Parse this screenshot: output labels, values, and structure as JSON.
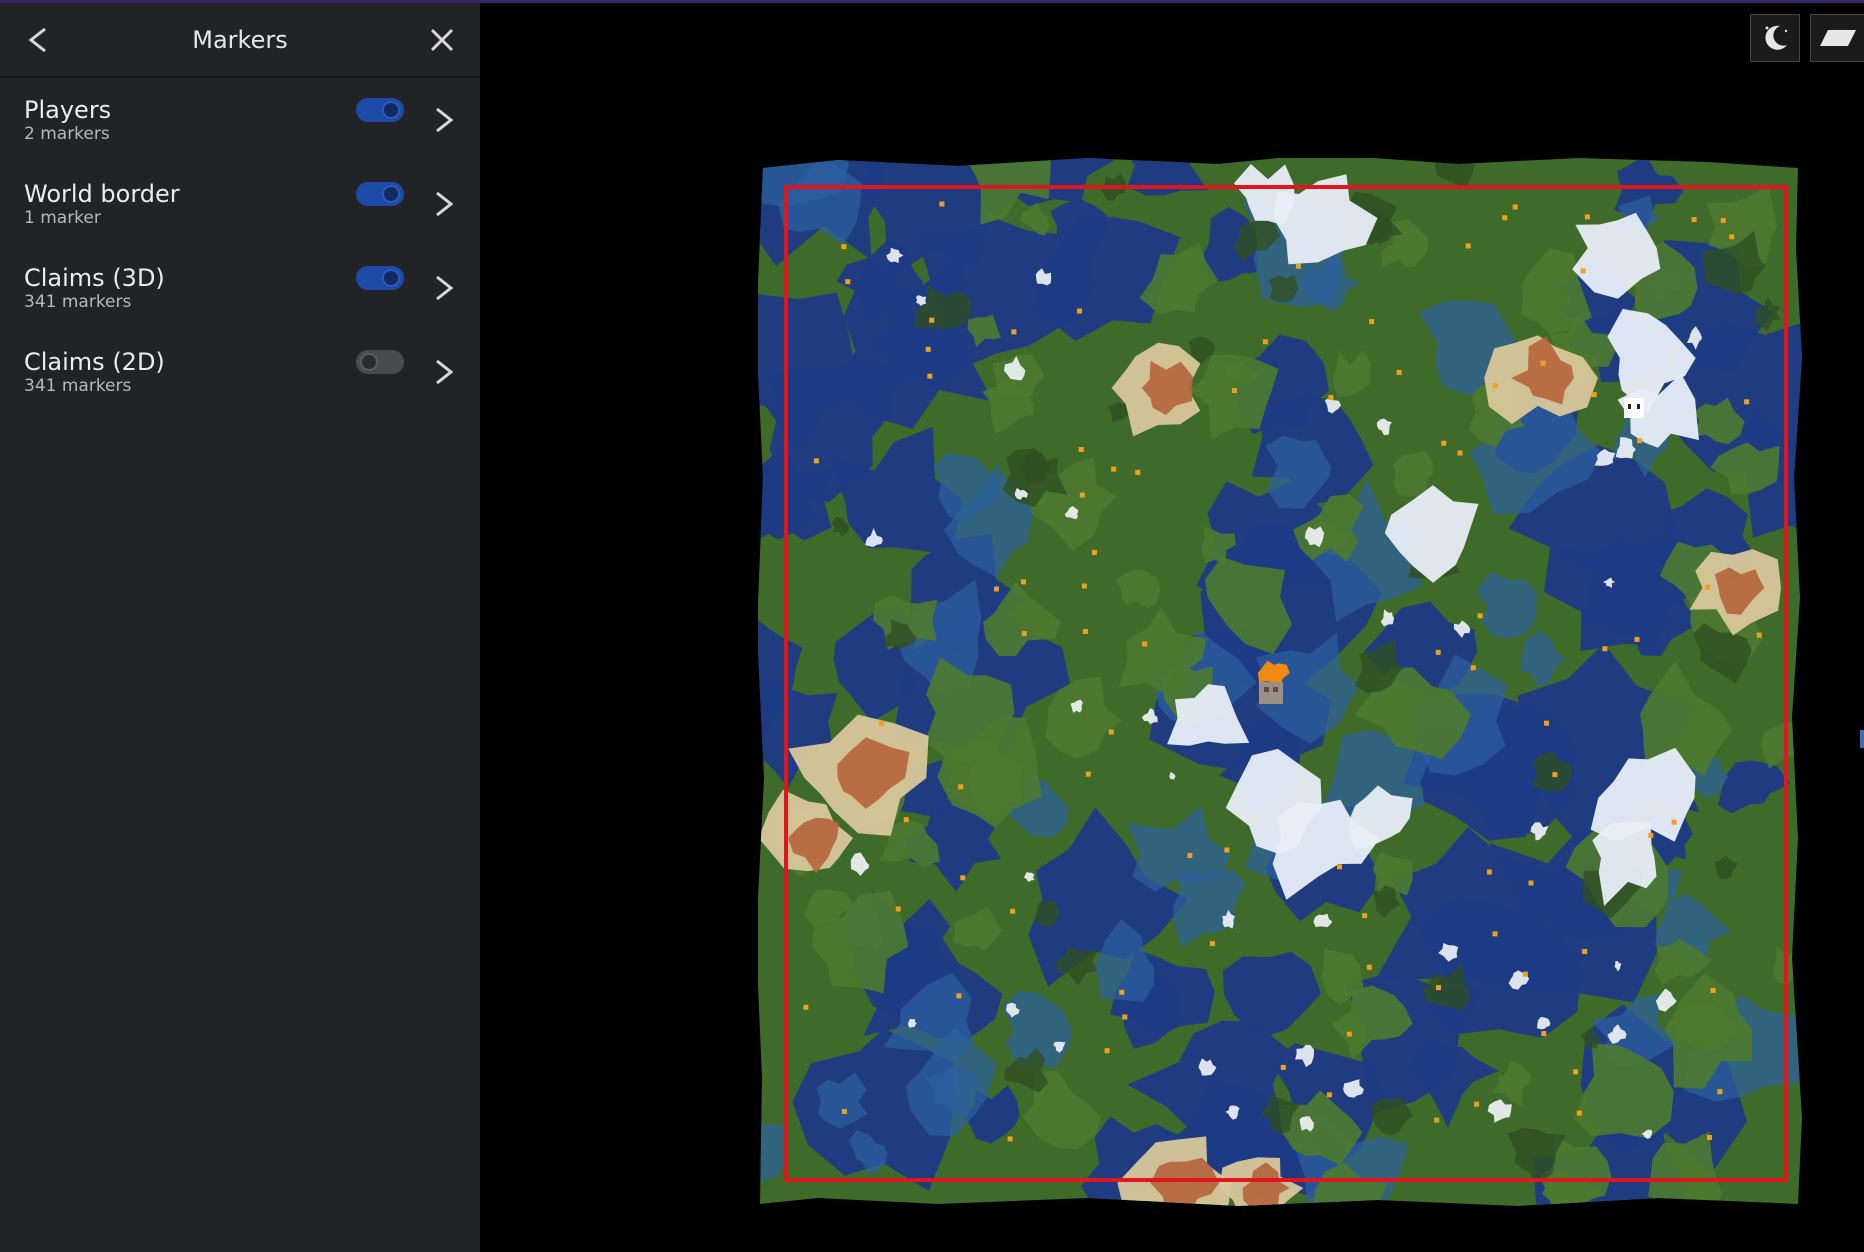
{
  "sidebar": {
    "title": "Markers",
    "back_icon": "chevron-left-icon",
    "close_icon": "close-icon",
    "items": [
      {
        "label": "Players",
        "count": "2 markers",
        "enabled": true
      },
      {
        "label": "World border",
        "count": "1 marker",
        "enabled": true
      },
      {
        "label": "Claims (3D)",
        "count": "341 markers",
        "enabled": true
      },
      {
        "label": "Claims (2D)",
        "count": "341 markers",
        "enabled": false
      }
    ]
  },
  "controls": {
    "night_icon": "moon-icon",
    "view_icon": "flat-view-icon"
  },
  "colors": {
    "sidebar_bg": "#222326",
    "toggle_on": "#1f4ba8",
    "toggle_off": "#4a4b4e",
    "world_border": "#e0161e",
    "ocean": "#1d3a85",
    "land": "#3f6b2a",
    "snow": "#e8eef8",
    "badlands": "#b5643a"
  }
}
